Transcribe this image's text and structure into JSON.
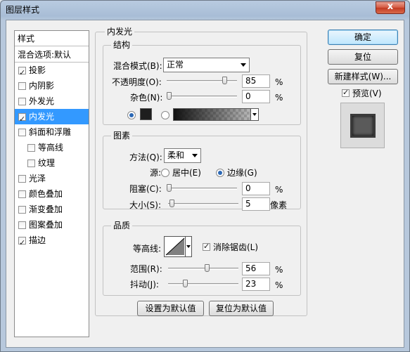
{
  "window": {
    "title": "图层样式",
    "close_label": "x"
  },
  "style_list": {
    "header": "样式",
    "blend_row": "混合选项:默认",
    "items": [
      {
        "label": "投影",
        "checked": true,
        "indent": false,
        "selected": false
      },
      {
        "label": "内阴影",
        "checked": false,
        "indent": false,
        "selected": false
      },
      {
        "label": "外发光",
        "checked": false,
        "indent": false,
        "selected": false
      },
      {
        "label": "内发光",
        "checked": true,
        "indent": false,
        "selected": true
      },
      {
        "label": "斜面和浮雕",
        "checked": false,
        "indent": false,
        "selected": false
      },
      {
        "label": "等高线",
        "checked": false,
        "indent": true,
        "selected": false
      },
      {
        "label": "纹理",
        "checked": false,
        "indent": true,
        "selected": false
      },
      {
        "label": "光泽",
        "checked": false,
        "indent": false,
        "selected": false
      },
      {
        "label": "颜色叠加",
        "checked": false,
        "indent": false,
        "selected": false
      },
      {
        "label": "渐变叠加",
        "checked": false,
        "indent": false,
        "selected": false
      },
      {
        "label": "图案叠加",
        "checked": false,
        "indent": false,
        "selected": false
      },
      {
        "label": "描边",
        "checked": true,
        "indent": false,
        "selected": false
      }
    ]
  },
  "panel": {
    "title": "内发光",
    "structure": {
      "legend": "结构",
      "blend_mode_label": "混合模式(B):",
      "blend_mode_value": "正常",
      "opacity_label": "不透明度(O):",
      "opacity_value": "85",
      "opacity_fraction": 0.85,
      "noise_label": "杂色(N):",
      "noise_value": "0",
      "noise_fraction": 0.0,
      "percent": "%",
      "color_swatch": "#1e1e1e"
    },
    "elements": {
      "legend": "图素",
      "method_label": "方法(Q):",
      "method_value": "柔和",
      "source_label": "源:",
      "source_center": "居中(E)",
      "source_edge": "边缘(G)",
      "choke_label": "阻塞(C):",
      "choke_value": "0",
      "choke_fraction": 0.0,
      "size_label": "大小(S):",
      "size_value": "5",
      "size_fraction": 0.02,
      "size_unit": "像素",
      "percent": "%"
    },
    "quality": {
      "legend": "品质",
      "contour_label": "等高线:",
      "antialias_label": "消除锯齿(L)",
      "range_label": "范围(R):",
      "range_value": "56",
      "range_fraction": 0.56,
      "jitter_label": "抖动(J):",
      "jitter_value": "23",
      "jitter_fraction": 0.23,
      "percent": "%"
    },
    "make_default": "设置为默认值",
    "reset_default": "复位为默认值"
  },
  "right": {
    "ok": "确定",
    "reset": "复位",
    "new_style": "新建样式(W)...",
    "preview_label": "预览(V)"
  }
}
